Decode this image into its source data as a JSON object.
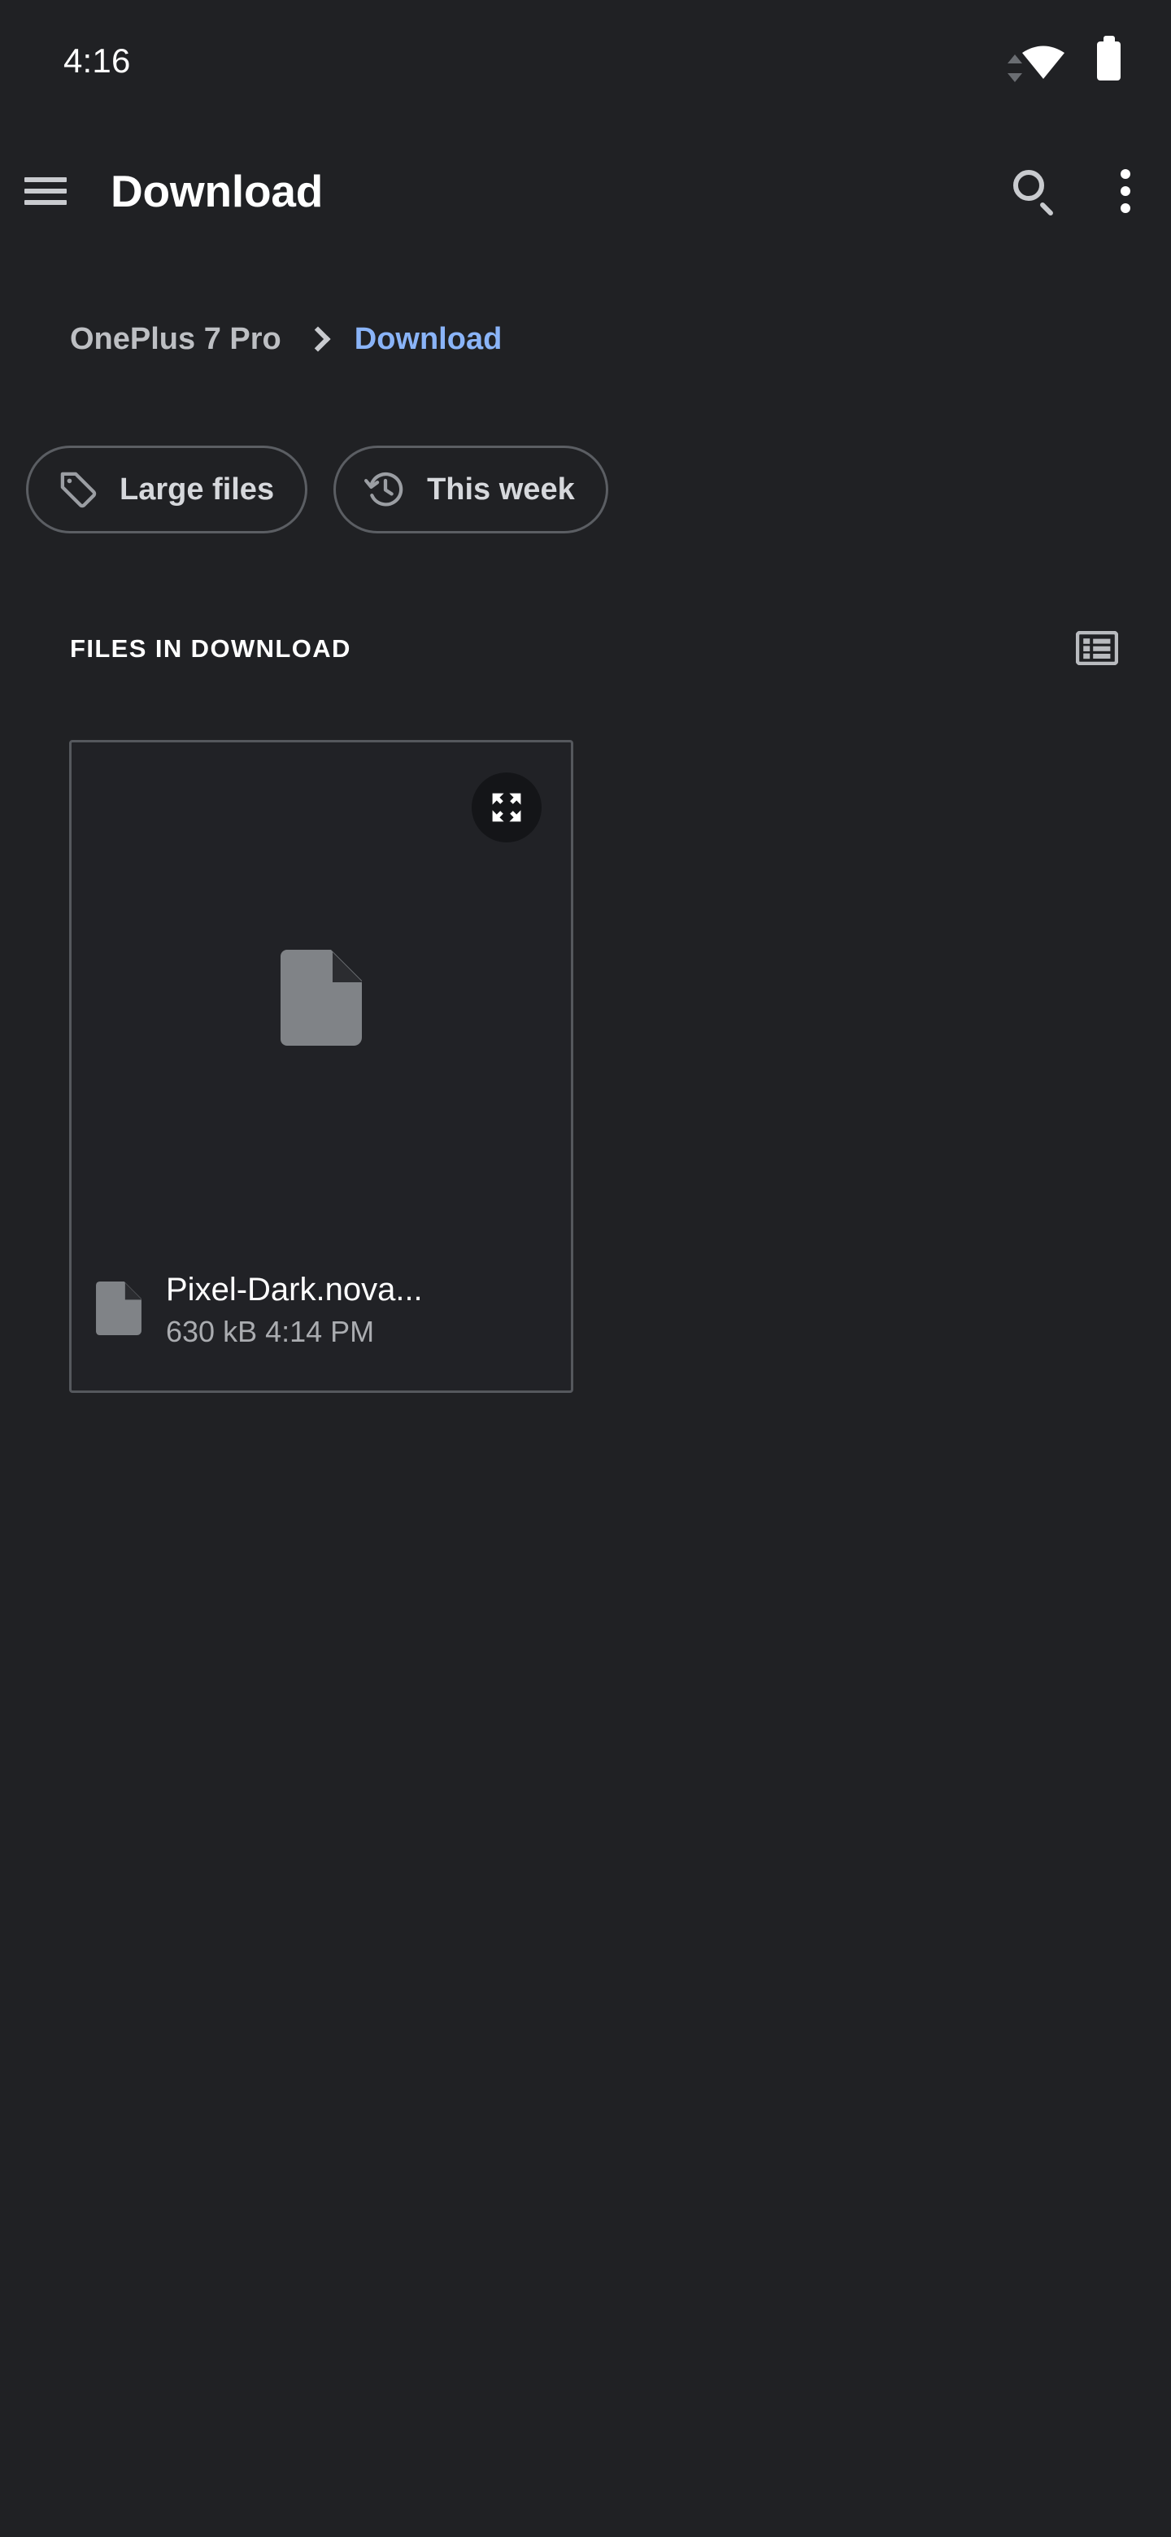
{
  "status_bar": {
    "time": "4:16",
    "icons": [
      "wifi-icon",
      "battery-icon"
    ]
  },
  "app_bar": {
    "menu_icon": "hamburger-menu-icon",
    "title": "Download",
    "search_icon": "search-icon",
    "overflow_icon": "overflow-menu-icon"
  },
  "breadcrumb": {
    "items": [
      {
        "label": "OnePlus 7 Pro",
        "active": false
      },
      {
        "label": "Download",
        "active": true
      }
    ],
    "separator": "chevron-right-icon"
  },
  "chips": [
    {
      "label": "Large files",
      "icon": "tag-icon"
    },
    {
      "label": "This week",
      "icon": "history-clock-icon"
    }
  ],
  "section": {
    "title": "FILES IN DOWNLOAD",
    "view_toggle_icon": "list-view-icon"
  },
  "files": [
    {
      "name": "Pixel-Dark.nova...",
      "meta": "630 kB  4:14 PM",
      "size": "630 kB",
      "time": "4:14 PM",
      "thumb_icon": "document-file-icon",
      "badge_icon": "document-file-icon",
      "expand_icon": "expand-fullscreen-icon"
    }
  ],
  "colors": {
    "background": "#202124",
    "accent_blue": "#8ab4f8",
    "text_primary": "#ffffff",
    "text_secondary": "#aaacb0",
    "border": "#55585d",
    "icon_gray": "#808387"
  }
}
